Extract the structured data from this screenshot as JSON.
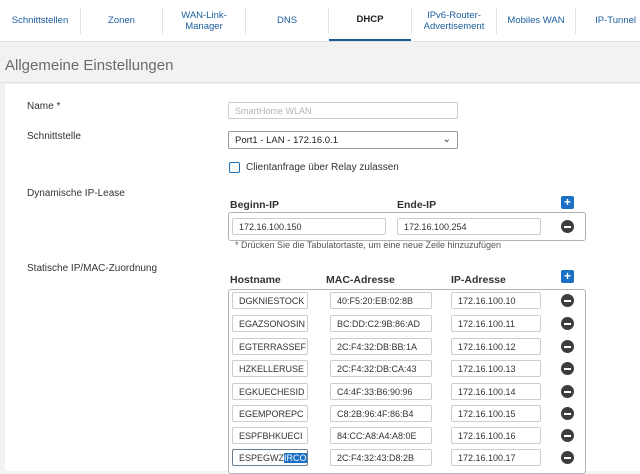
{
  "tabs": [
    {
      "label": "Schnittstellen",
      "active": false
    },
    {
      "label": "Zonen",
      "active": false
    },
    {
      "label": "WAN-Link-\nManager",
      "active": false
    },
    {
      "label": "DNS",
      "active": false
    },
    {
      "label": "DHCP",
      "active": true
    },
    {
      "label": "IPv6-Router-\nAdvertisement",
      "active": false
    },
    {
      "label": "Mobiles WAN",
      "active": false
    },
    {
      "label": "IP-Tunnel",
      "active": false
    }
  ],
  "section": {
    "title": "Allgemeine Einstellungen"
  },
  "form": {
    "name_label": "Name *",
    "name_placeholder": "SmartHome WLAN",
    "interface_label": "Schnittstelle",
    "interface_value": "Port1 - LAN - 172.16.0.1",
    "relay_label": "Clientanfrage über Relay zulassen",
    "lease_label": "Dynamische IP-Lease",
    "lease_start_header": "Beginn-IP",
    "lease_end_header": "Ende-IP",
    "lease_start": "172.16.100.150",
    "lease_end": "172.16.100.254",
    "lease_hint": "* Drücken Sie die Tabulatortaste, um eine neue Zeile hinzuzufügen",
    "static_label": "Statische IP/MAC-Zuordnung",
    "static_headers": {
      "hostname": "Hostname",
      "mac": "MAC-Adresse",
      "ip": "IP-Adresse"
    },
    "static_rows": [
      {
        "hostname": "DGKNIESTOCK",
        "mac": "40:F5:20:EB:02:8B",
        "ip": "172.16.100.10"
      },
      {
        "hostname": "EGAZSONOSIN",
        "mac": "BC:DD:C2:9B:86:AD",
        "ip": "172.16.100.11"
      },
      {
        "hostname": "EGTERRASSEF",
        "mac": "2C:F4:32:DB:BB:1A",
        "ip": "172.16.100.12"
      },
      {
        "hostname": "HZKELLERUSE",
        "mac": "2C:F4:32:DB:CA:43",
        "ip": "172.16.100.13"
      },
      {
        "hostname": "EGKUECHESID",
        "mac": "C4:4F:33:B6:90:96",
        "ip": "172.16.100.14"
      },
      {
        "hostname": "EGEMPOREPC",
        "mac": "C8:2B:96:4F:86:B4",
        "ip": "172.16.100.15"
      },
      {
        "hostname": "ESPFBHKUECI",
        "mac": "84:CC:A8:A4:A8:0E",
        "ip": "172.16.100.16"
      },
      {
        "hostname": "ESPEGWZ",
        "hostname_selected": "IRCO",
        "mac": "2C:F4:32:43:D8:2B",
        "ip": "172.16.100.17"
      }
    ]
  },
  "icons": {
    "add": "plus-icon",
    "remove": "minus-circle-icon",
    "dropdown": "chevron-down-icon"
  },
  "colors": {
    "accent": "#1b6fc4",
    "checkbox": "#1a6fb8"
  }
}
